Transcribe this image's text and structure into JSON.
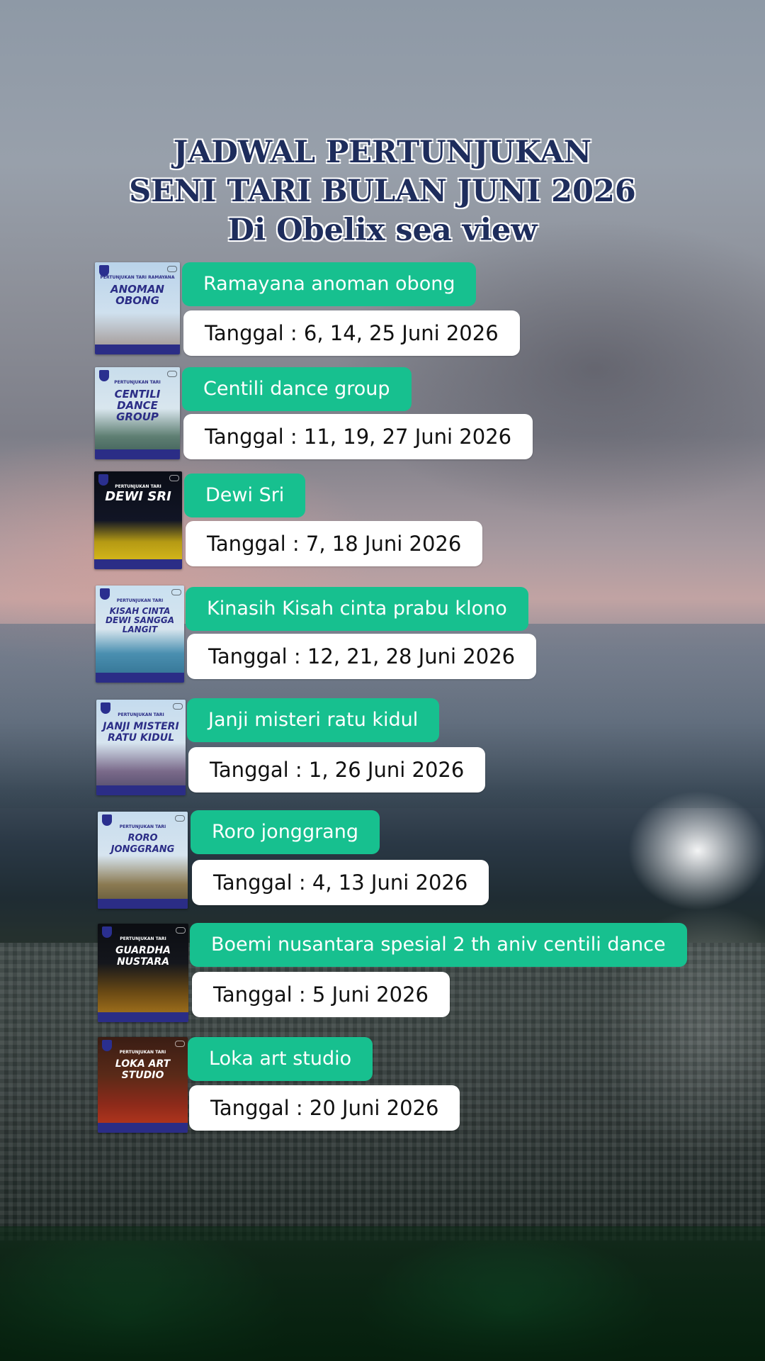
{
  "title": {
    "line1": "JADWAL PERTUNJUKAN",
    "line2": "SENI TARI BULAN JUNI 2026",
    "line3": "Di Obelix sea view"
  },
  "events": [
    {
      "name": "Ramayana anoman obong",
      "date": "Tanggal : 6, 14, 25 Juni 2026",
      "poster_title": "ANOMAN OBONG",
      "poster_subtitle": "PERTUNJUKAN TARI RAMAYANA"
    },
    {
      "name": "Centili dance group",
      "date": "Tanggal : 11, 19, 27 Juni 2026",
      "poster_title": "CENTILI DANCE GROUP",
      "poster_subtitle": "PERTUNJUKAN TARI"
    },
    {
      "name": "Dewi Sri",
      "date": "Tanggal : 7, 18 Juni 2026",
      "poster_title": "DEWI SRI",
      "poster_subtitle": "PERTUNJUKAN TARI"
    },
    {
      "name": "Kinasih Kisah cinta prabu klono",
      "date": "Tanggal : 12, 21, 28 Juni 2026",
      "poster_title": "KISAH CINTA DEWI SANGGA LANGIT",
      "poster_subtitle": "PERTUNJUKAN TARI"
    },
    {
      "name": "Janji misteri ratu kidul",
      "date": "Tanggal : 1, 26 Juni 2026",
      "poster_title": "JANJI MISTERI RATU KIDUL",
      "poster_subtitle": "PERTUNJUKAN TARI"
    },
    {
      "name": "Roro jonggrang",
      "date": "Tanggal : 4, 13 Juni 2026",
      "poster_title": "RORO JONGGRANG",
      "poster_subtitle": "PERTUNJUKAN TARI"
    },
    {
      "name": "Boemi nusantara spesial 2 th aniv centili dance",
      "date": "Tanggal : 5 Juni 2026",
      "poster_title": "GUARDHA NUSTARA",
      "poster_subtitle": "PERTUNJUKAN TARI"
    },
    {
      "name": "Loka art studio",
      "date": "Tanggal : 20 Juni 2026",
      "poster_title": "LOKA ART STUDIO",
      "poster_subtitle": "PERTUNJUKAN TARI"
    }
  ],
  "colors": {
    "name_pill": "#17c08f",
    "date_pill": "#ffffff",
    "title_text": "#1e2d5c",
    "poster_band": "#2b2d86"
  },
  "icons": [
    "logo-icon"
  ]
}
